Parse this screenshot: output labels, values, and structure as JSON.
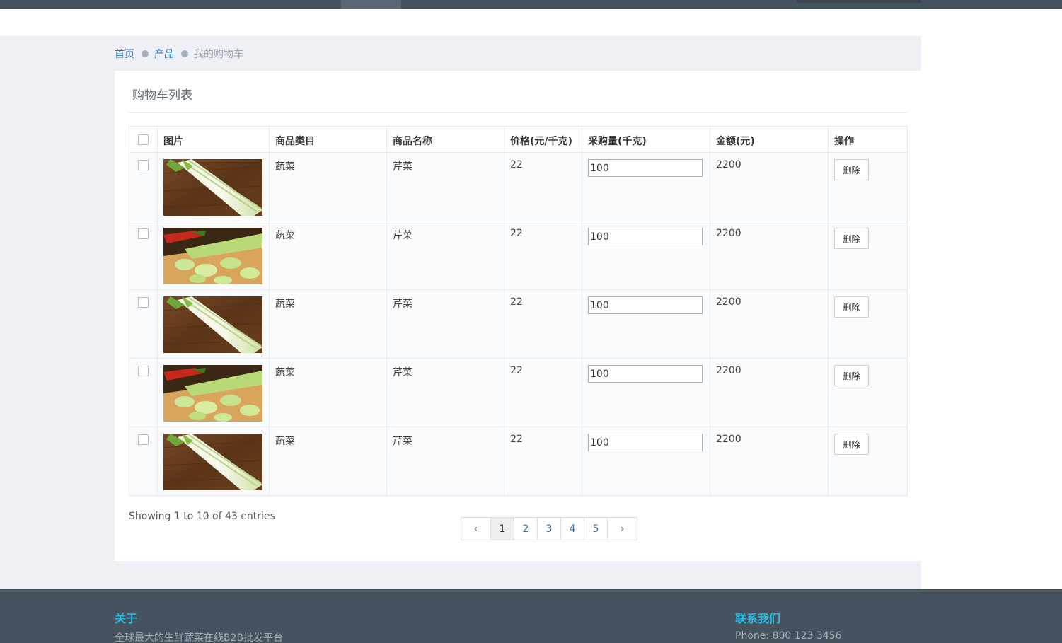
{
  "breadcrumb": {
    "home": "首页",
    "products": "产品",
    "current": "我的购物车"
  },
  "panel": {
    "title": "购物车列表"
  },
  "table": {
    "headers": {
      "image": "图片",
      "category": "商品类目",
      "name": "商品名称",
      "price": "价格(元/千克)",
      "quantity": "采购量(千克)",
      "amount": "金额(元)",
      "action": "操作"
    },
    "rows": [
      {
        "category": "蔬菜",
        "name": "芹菜",
        "price": "22",
        "quantity": "100",
        "amount": "2200",
        "delete_label": "删除",
        "image": "celery-whole"
      },
      {
        "category": "蔬菜",
        "name": "芹菜",
        "price": "22",
        "quantity": "100",
        "amount": "2200",
        "delete_label": "删除",
        "image": "celery-sliced"
      },
      {
        "category": "蔬菜",
        "name": "芹菜",
        "price": "22",
        "quantity": "100",
        "amount": "2200",
        "delete_label": "删除",
        "image": "celery-whole"
      },
      {
        "category": "蔬菜",
        "name": "芹菜",
        "price": "22",
        "quantity": "100",
        "amount": "2200",
        "delete_label": "删除",
        "image": "celery-sliced"
      },
      {
        "category": "蔬菜",
        "name": "芹菜",
        "price": "22",
        "quantity": "100",
        "amount": "2200",
        "delete_label": "删除",
        "image": "celery-whole"
      }
    ]
  },
  "pagination": {
    "info": "Showing 1 to 10 of 43 entries",
    "prev": "‹",
    "next": "›",
    "pages": [
      "1",
      "2",
      "3",
      "4",
      "5"
    ],
    "current_page": "1"
  },
  "footer": {
    "about_title": "关于",
    "about_text": "全球最大的生鲜蔬菜在线B2B批发平台",
    "contact_title": "联系我们",
    "contact_text": "Phone: 800 123 3456"
  },
  "colors": {
    "topbar": "#47525f",
    "accent": "#2ab7e0",
    "link": "#2a6fa8"
  }
}
